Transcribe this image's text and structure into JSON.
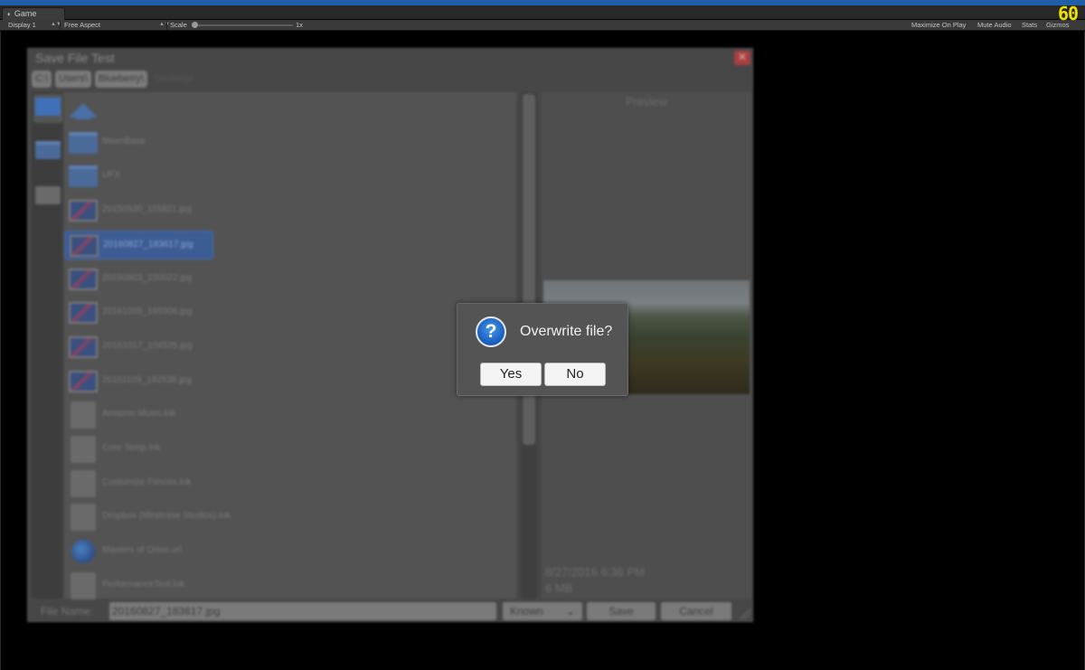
{
  "editor": {
    "tab_label": "Game",
    "display": "Display 1",
    "aspect": "Free Aspect",
    "scale_label": "Scale",
    "scale_value": "1x",
    "scale_fraction": 0,
    "maximize": "Maximize On Play",
    "mute": "Mute Audio",
    "stats": "Stats",
    "gizmos": "Gizmos",
    "fps": "60"
  },
  "file_dialog": {
    "title": "Save File Test",
    "breadcrumbs": [
      "C:\\",
      "Users\\",
      "Blueberry\\",
      "Desktop\\"
    ],
    "items": [
      {
        "name": "",
        "kind": "up"
      },
      {
        "name": "MeenBase",
        "kind": "folder"
      },
      {
        "name": "UFX",
        "kind": "folder"
      },
      {
        "name": "20150530_115821.jpg",
        "kind": "image"
      },
      {
        "name": "20160827_183617.jpg",
        "kind": "image",
        "selected": true
      },
      {
        "name": "20160903_150022.jpg",
        "kind": "image"
      },
      {
        "name": "20161005_165506.jpg",
        "kind": "image"
      },
      {
        "name": "20161017_104525.jpg",
        "kind": "image"
      },
      {
        "name": "20161109_182638.jpg",
        "kind": "image"
      },
      {
        "name": "Amazon Music.lnk",
        "kind": "doc"
      },
      {
        "name": "Core Temp.lnk",
        "kind": "doc"
      },
      {
        "name": "Customize Fences.lnk",
        "kind": "doc"
      },
      {
        "name": "Dropbox (Mindcase Studios).lnk",
        "kind": "doc"
      },
      {
        "name": "Masters of Orion.url",
        "kind": "globe"
      },
      {
        "name": "PerformanceTest.lnk",
        "kind": "doc"
      }
    ],
    "preview_label": "Preview",
    "preview_date": "8/27/2016 6:36 PM",
    "preview_size": "6 MB",
    "file_name_label": "File Name:",
    "file_name_value": "20160827_183617.jpg",
    "filter_value": "Known",
    "save_label": "Save",
    "cancel_label": "Cancel"
  },
  "modal": {
    "message": "Overwrite file?",
    "yes_label": "Yes",
    "no_label": "No"
  }
}
